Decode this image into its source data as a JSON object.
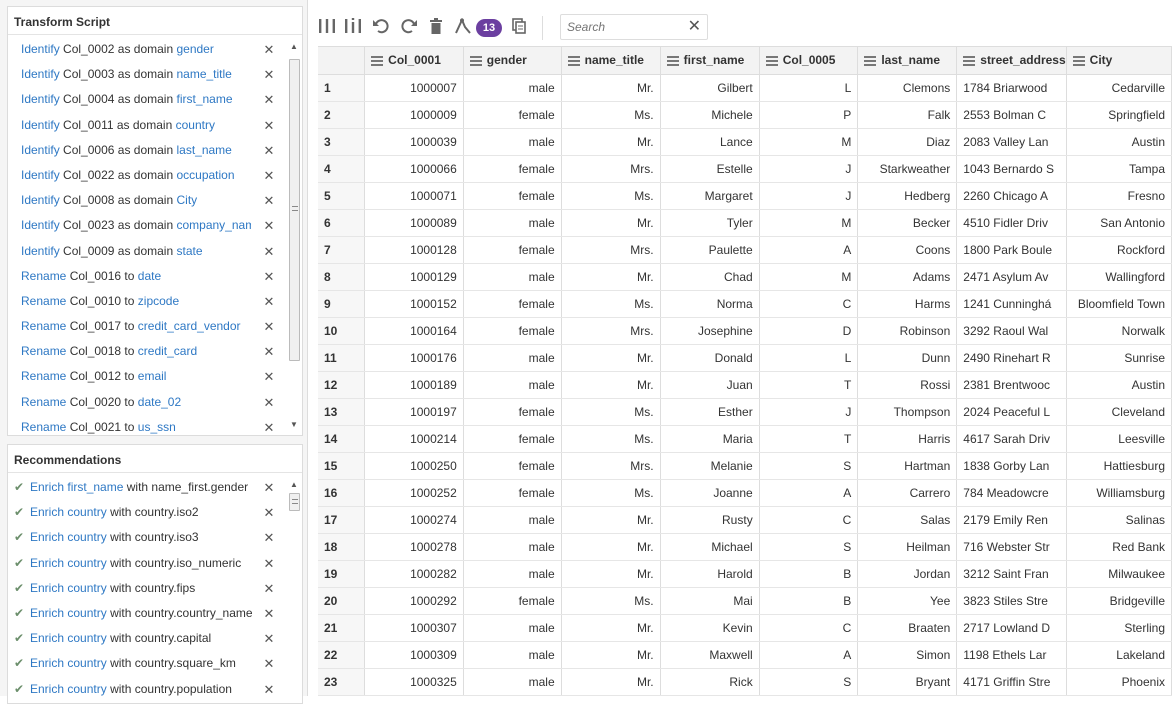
{
  "script_panel": {
    "title": "Transform Script",
    "items": [
      {
        "verb": "Identify",
        "col": "Col_0002",
        "mid": "as domain",
        "target": "gender"
      },
      {
        "verb": "Identify",
        "col": "Col_0003",
        "mid": "as domain",
        "target": "name_title"
      },
      {
        "verb": "Identify",
        "col": "Col_0004",
        "mid": "as domain",
        "target": "first_name"
      },
      {
        "verb": "Identify",
        "col": "Col_0011",
        "mid": "as domain",
        "target": "country"
      },
      {
        "verb": "Identify",
        "col": "Col_0006",
        "mid": "as domain",
        "target": "last_name"
      },
      {
        "verb": "Identify",
        "col": "Col_0022",
        "mid": "as domain",
        "target": "occupation"
      },
      {
        "verb": "Identify",
        "col": "Col_0008",
        "mid": "as domain",
        "target": "City"
      },
      {
        "verb": "Identify",
        "col": "Col_0023",
        "mid": "as domain",
        "target": "company_name"
      },
      {
        "verb": "Identify",
        "col": "Col_0009",
        "mid": "as domain",
        "target": "state"
      },
      {
        "verb": "Rename",
        "col": "Col_0016",
        "mid": "to",
        "target": "date"
      },
      {
        "verb": "Rename",
        "col": "Col_0010",
        "mid": "to",
        "target": "zipcode"
      },
      {
        "verb": "Rename",
        "col": "Col_0017",
        "mid": "to",
        "target": "credit_card_vendor"
      },
      {
        "verb": "Rename",
        "col": "Col_0018",
        "mid": "to",
        "target": "credit_card"
      },
      {
        "verb": "Rename",
        "col": "Col_0012",
        "mid": "to",
        "target": "email"
      },
      {
        "verb": "Rename",
        "col": "Col_0020",
        "mid": "to",
        "target": "date_02"
      },
      {
        "verb": "Rename",
        "col": "Col_0021",
        "mid": "to",
        "target": "us_ssn"
      }
    ]
  },
  "rec_panel": {
    "title": "Recommendations",
    "items": [
      {
        "verb": "Enrich",
        "col": "first_name",
        "rest": "with name_first.gender"
      },
      {
        "verb": "Enrich",
        "col": "country",
        "rest": "with country.iso2"
      },
      {
        "verb": "Enrich",
        "col": "country",
        "rest": "with country.iso3"
      },
      {
        "verb": "Enrich",
        "col": "country",
        "rest": "with country.iso_numeric"
      },
      {
        "verb": "Enrich",
        "col": "country",
        "rest": "with country.fips"
      },
      {
        "verb": "Enrich",
        "col": "country",
        "rest": "with country.country_name"
      },
      {
        "verb": "Enrich",
        "col": "country",
        "rest": "with country.capital"
      },
      {
        "verb": "Enrich",
        "col": "country",
        "rest": "with country.square_km"
      },
      {
        "verb": "Enrich",
        "col": "country",
        "rest": "with country.population"
      }
    ]
  },
  "toolbar": {
    "badge": "13",
    "search_placeholder": "Search"
  },
  "grid": {
    "columns": [
      "Col_0001",
      "gender",
      "name_title",
      "first_name",
      "Col_0005",
      "last_name",
      "street_address",
      "City"
    ],
    "rows": [
      [
        "1",
        "1000007",
        "male",
        "Mr.",
        "Gilbert",
        "L",
        "Clemons",
        "1784 Briarwood",
        "Cedarville"
      ],
      [
        "2",
        "1000009",
        "female",
        "Ms.",
        "Michele",
        "P",
        "Falk",
        "2553 Bolman C",
        "Springfield"
      ],
      [
        "3",
        "1000039",
        "male",
        "Mr.",
        "Lance",
        "M",
        "Diaz",
        "2083 Valley Lan",
        "Austin"
      ],
      [
        "4",
        "1000066",
        "female",
        "Mrs.",
        "Estelle",
        "J",
        "Starkweather",
        "1043 Bernardo S",
        "Tampa"
      ],
      [
        "5",
        "1000071",
        "female",
        "Ms.",
        "Margaret",
        "J",
        "Hedberg",
        "2260 Chicago A",
        "Fresno"
      ],
      [
        "6",
        "1000089",
        "male",
        "Mr.",
        "Tyler",
        "M",
        "Becker",
        "4510 Fidler Driv",
        "San Antonio"
      ],
      [
        "7",
        "1000128",
        "female",
        "Mrs.",
        "Paulette",
        "A",
        "Coons",
        "1800 Park Boule",
        "Rockford"
      ],
      [
        "8",
        "1000129",
        "male",
        "Mr.",
        "Chad",
        "M",
        "Adams",
        "2471 Asylum Av",
        "Wallingford"
      ],
      [
        "9",
        "1000152",
        "female",
        "Ms.",
        "Norma",
        "C",
        "Harms",
        "1241 Cunninghá",
        "Bloomfield Town"
      ],
      [
        "10",
        "1000164",
        "female",
        "Mrs.",
        "Josephine",
        "D",
        "Robinson",
        "3292 Raoul Wal",
        "Norwalk"
      ],
      [
        "11",
        "1000176",
        "male",
        "Mr.",
        "Donald",
        "L",
        "Dunn",
        "2490 Rinehart R",
        "Sunrise"
      ],
      [
        "12",
        "1000189",
        "male",
        "Mr.",
        "Juan",
        "T",
        "Rossi",
        "2381 Brentwooc",
        "Austin"
      ],
      [
        "13",
        "1000197",
        "female",
        "Ms.",
        "Esther",
        "J",
        "Thompson",
        "2024 Peaceful L",
        "Cleveland"
      ],
      [
        "14",
        "1000214",
        "female",
        "Ms.",
        "Maria",
        "T",
        "Harris",
        "4617 Sarah Driv",
        "Leesville"
      ],
      [
        "15",
        "1000250",
        "female",
        "Mrs.",
        "Melanie",
        "S",
        "Hartman",
        "1838 Gorby Lan",
        "Hattiesburg"
      ],
      [
        "16",
        "1000252",
        "female",
        "Ms.",
        "Joanne",
        "A",
        "Carrero",
        "784 Meadowcre",
        "Williamsburg"
      ],
      [
        "17",
        "1000274",
        "male",
        "Mr.",
        "Rusty",
        "C",
        "Salas",
        "2179 Emily Ren",
        "Salinas"
      ],
      [
        "18",
        "1000278",
        "male",
        "Mr.",
        "Michael",
        "S",
        "Heilman",
        "716 Webster Str",
        "Red Bank"
      ],
      [
        "19",
        "1000282",
        "male",
        "Mr.",
        "Harold",
        "B",
        "Jordan",
        "3212 Saint Fran",
        "Milwaukee"
      ],
      [
        "20",
        "1000292",
        "female",
        "Ms.",
        "Mai",
        "B",
        "Yee",
        "3823 Stiles Stre",
        "Bridgeville"
      ],
      [
        "21",
        "1000307",
        "male",
        "Mr.",
        "Kevin",
        "C",
        "Braaten",
        "2717 Lowland D",
        "Sterling"
      ],
      [
        "22",
        "1000309",
        "male",
        "Mr.",
        "Maxwell",
        "A",
        "Simon",
        "1198 Ethels Lar",
        "Lakeland"
      ],
      [
        "23",
        "1000325",
        "male",
        "Mr.",
        "Rick",
        "S",
        "Bryant",
        "4171 Griffin Stre",
        "Phoenix"
      ]
    ]
  }
}
